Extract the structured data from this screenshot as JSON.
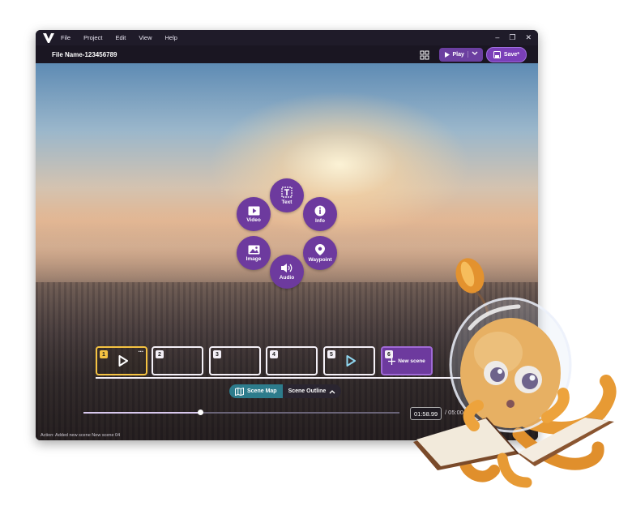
{
  "menubar": {
    "items": [
      "File",
      "Project",
      "Edit",
      "View",
      "Help"
    ],
    "controls": [
      "–",
      "❐",
      "✕"
    ]
  },
  "toolbar": {
    "file_name": "File Name-123456789",
    "play_label": "Play",
    "save_label": "Save*"
  },
  "insert_menu": {
    "items": [
      {
        "label": "Text",
        "icon": "text-box-icon"
      },
      {
        "label": "Info",
        "icon": "info-icon"
      },
      {
        "label": "Waypoint",
        "icon": "location-pin-icon"
      },
      {
        "label": "Audio",
        "icon": "speaker-icon"
      },
      {
        "label": "Image",
        "icon": "image-icon"
      },
      {
        "label": "Video",
        "icon": "video-play-icon"
      }
    ]
  },
  "scenes": {
    "items": [
      {
        "number": "1",
        "active": true,
        "has_play": true
      },
      {
        "number": "2",
        "active": false,
        "has_play": false
      },
      {
        "number": "3",
        "active": false,
        "has_play": false
      },
      {
        "number": "4",
        "active": false,
        "has_play": false
      },
      {
        "number": "5",
        "active": false,
        "has_play": true
      }
    ],
    "new_scene_number": "6",
    "new_scene_label": "New scene",
    "more_label": "···"
  },
  "tabs": {
    "scene_map": "Scene Map",
    "scene_outline": "Scene Outline"
  },
  "playback": {
    "current_time": "01:58.99",
    "total_time": "/ 05:00.0",
    "progress": 0.37
  },
  "status": {
    "text": "Action: Added new scene New scene 04"
  },
  "colors": {
    "accent_purple": "#6d3a9e",
    "active_scene": "#f5c342",
    "tab_teal": "#2d7c8c"
  }
}
